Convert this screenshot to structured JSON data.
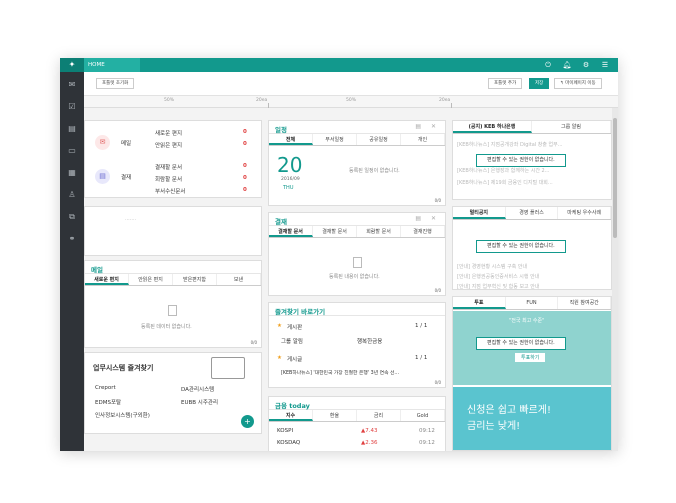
{
  "app": {
    "home_tab": "HOME",
    "logo": "✦"
  },
  "top_icons": [
    "power-icon",
    "bell-icon",
    "gear-icon",
    "menu-icon"
  ],
  "toolbar": {
    "reset_label": "포틀렛 초기화",
    "add_label": "포틀렛 추가",
    "save_label": "저장",
    "move_label": "↰ 마이페이지 이동"
  },
  "ruler": {
    "marks": [
      "50%",
      "20ea",
      "50%",
      "20ea"
    ]
  },
  "summary": {
    "mail_label": "메일",
    "approval_label": "결재",
    "rows": [
      {
        "label": "새로운 편지",
        "value": "0"
      },
      {
        "label": "안읽은 편지",
        "value": "0"
      },
      {
        "label": "결재할 문서",
        "value": "0"
      },
      {
        "label": "회람할 문서",
        "value": "0"
      },
      {
        "label": "부서수신문서",
        "value": "0"
      }
    ]
  },
  "schedule": {
    "title": "일정",
    "tabs": [
      "전체",
      "부서일정",
      "공유일정",
      "개인"
    ],
    "day": "20",
    "date": "2016/09",
    "weekday": "THU",
    "empty": "등록된 일정이 없습니다.",
    "count": "0/0"
  },
  "approval": {
    "title": "결재",
    "tabs": [
      "결재할 문서",
      "결재할 문서",
      "회람할 문서",
      "결재진행"
    ],
    "empty": "등록된 내용이 없습니다.",
    "count": "0/0"
  },
  "mail": {
    "title": "메일",
    "tabs": [
      "새로운 편지",
      "안읽은 편지",
      "받은편지함",
      "보낸"
    ],
    "empty": "등록된 데이터 없습니다.",
    "count": "0/0"
  },
  "favorites": {
    "title": "즐겨찾기 바로가기",
    "sections": [
      {
        "name": "게시판",
        "page": "1 / 1",
        "items": [
          "그룹 알림",
          "행복한금융"
        ]
      },
      {
        "name": "게시글",
        "page": "1 / 1",
        "items": [
          "[KEB하나뉴스] '대한민국 가장 친절한 은행' 3년 연속 선..."
        ]
      }
    ],
    "count": "0/0"
  },
  "bizsys": {
    "title": "업무시스템 즐겨찾기",
    "links": [
      "Creport",
      "DA관리시스템",
      "EDMS포탈",
      "EUBB 시주관리",
      "인사정보시스템(구외환)"
    ]
  },
  "finance": {
    "title": "금융 today",
    "tabs": [
      "지수",
      "환율",
      "금리",
      "Gold"
    ],
    "rows": [
      {
        "name": "KOSPI",
        "change": "▲7.43",
        "time": "09:12"
      },
      {
        "name": "KOSDAQ",
        "change": "▲2.36",
        "time": "09:12"
      }
    ],
    "empty": "등록된 데이터가 없습니다."
  },
  "right_col": {
    "tabs1": [
      "(공지) KEB 하나은행",
      "그룹 알림"
    ],
    "tabs2": [
      "멀티공지",
      "경영 플러스",
      "마케팅 우수사례"
    ],
    "tabs3": [
      "투표",
      "FUN",
      "직원 참여공간"
    ],
    "overlay": "편집할 수 있는 권한이 없습니다.",
    "banner_top": "\"전국 최고 수준\"",
    "banner_btn": "투표하기",
    "banner_text1": "신청은 쉽고 빠르게!",
    "banner_text2": "금리는 낮게!",
    "ghost_lines": [
      "[KEB하나뉴스] 지점공개강좌 Digital 창출 업무...",
      "[KEB하나뉴스] 은행장과 함께하는 시간 2...",
      "[KEB하나뉴스] 제19회 금융인 디지털 대회...",
      "[안내] 경영현황 시스템 구축 안내",
      "[안내] 은행권공동인증서비스 시행 안내",
      "[안내] 지점 업무혁신 및 합동 보고 안내"
    ]
  },
  "colors": {
    "accent": "#12998d",
    "dark": "#2f3338",
    "alert": "#e04040"
  }
}
